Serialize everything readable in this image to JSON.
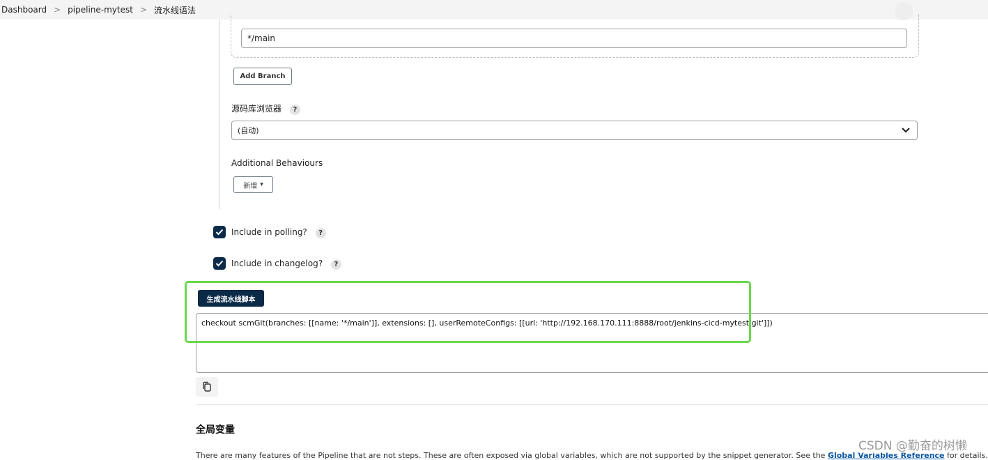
{
  "breadcrumb": {
    "items": [
      "Dashboard",
      "pipeline-mytest",
      "流水线语法"
    ],
    "separator": ">"
  },
  "branch_spec": {
    "value": "*/main"
  },
  "add_branch_label": "Add Branch",
  "repo_browser": {
    "label": "源码库浏览器",
    "help": "?",
    "selected": "(自动)"
  },
  "additional_behaviours": {
    "label": "Additional Behaviours",
    "add_label": "新增",
    "caret": "▾"
  },
  "options": [
    {
      "label": "Include in polling?",
      "checked": true,
      "help": "?"
    },
    {
      "label": "Include in changelog?",
      "checked": true,
      "help": "?"
    }
  ],
  "generate_button_label": "生成流水线脚本",
  "generated_script": "checkout scmGit(branches: [[name: '*/main']], extensions: [], userRemoteConfigs: [[url: 'http://192.168.170.111:8888/root/jenkins-cicd-mytest.git']])",
  "global_vars": {
    "title": "全局变量",
    "paragraph_prefix": "There are many features of the Pipeline that are not steps. These are often exposed via global variables, which are not supported by the snippet generator. See the ",
    "link_text": "Global Variables Reference",
    "paragraph_suffix": " for details."
  },
  "watermark": "CSDN @勤奋的树懒",
  "colors": {
    "primary": "#0b2a47",
    "highlight_border": "#6ad84f",
    "link": "#0b57a3"
  },
  "icons": {
    "breadcrumb_separator": "chevron-right-icon",
    "select": "chevron-down-icon",
    "checkbox": "check-icon",
    "copy": "copy-icon"
  }
}
